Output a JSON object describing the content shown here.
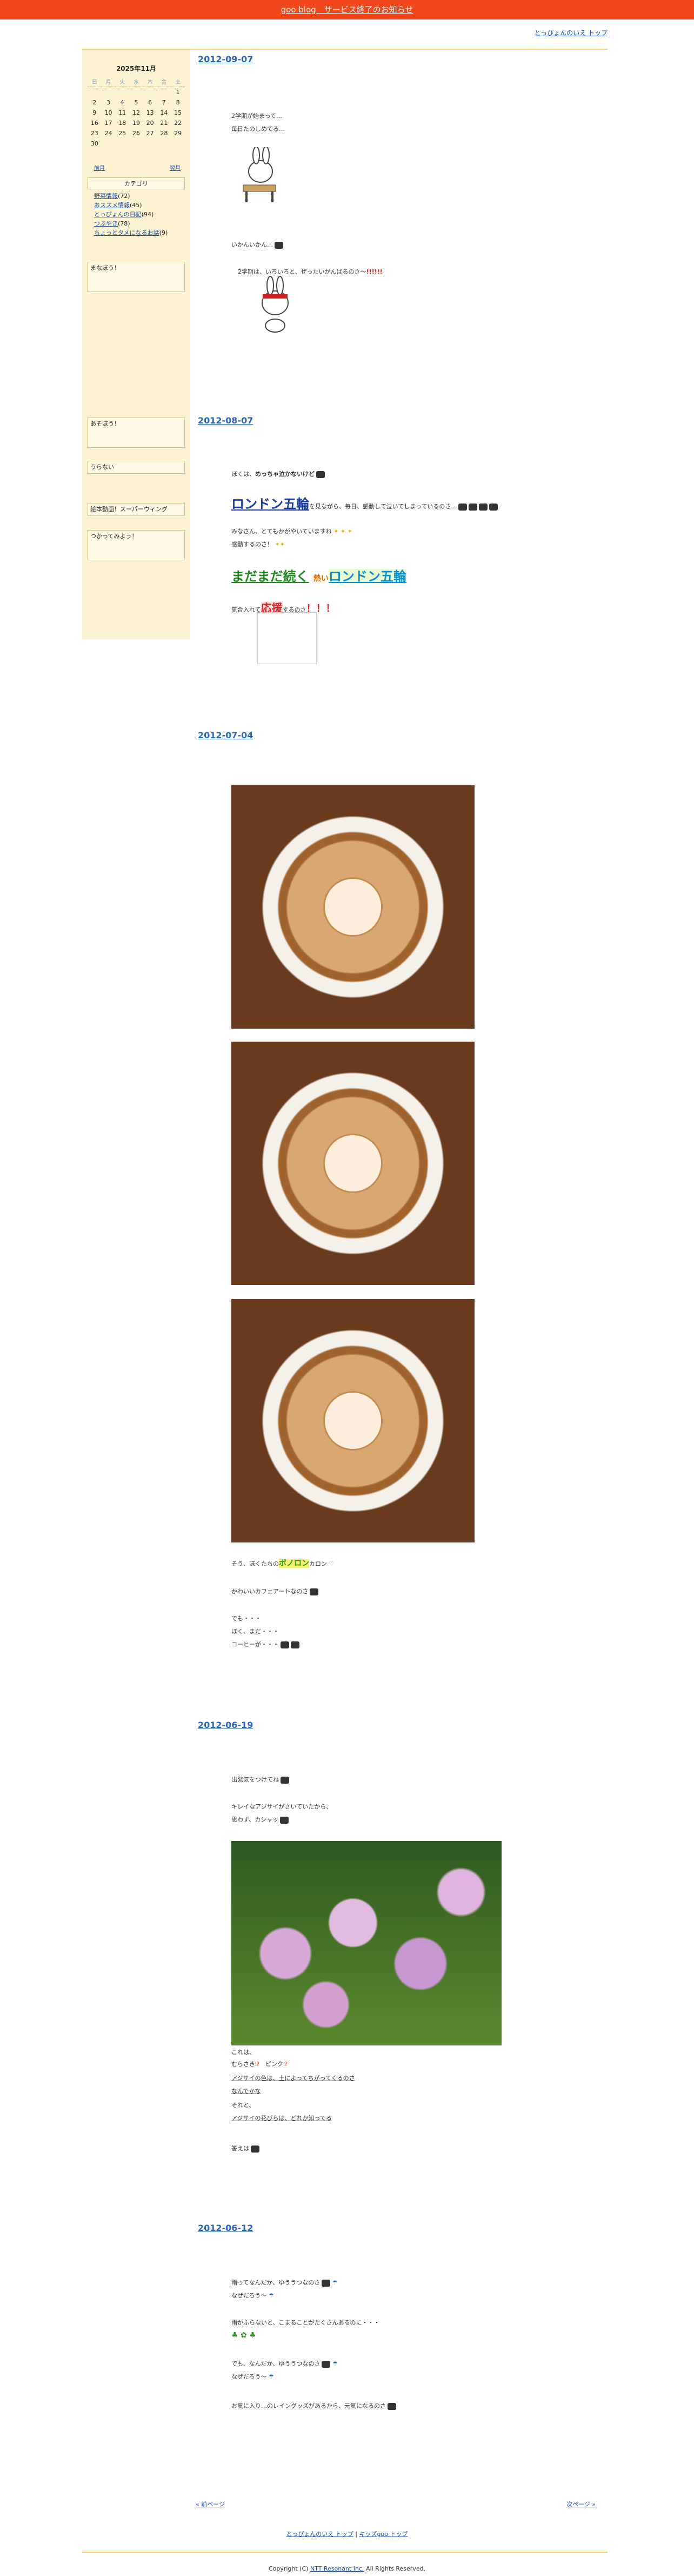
{
  "topbar": {
    "notice": "goo blog　サービス終了のお知らせ"
  },
  "header": {
    "top_link": "とっぴょんのいえ トップ"
  },
  "sidebar": {
    "calendar": {
      "title": "2025年11月",
      "weekdays": [
        "日",
        "月",
        "火",
        "水",
        "木",
        "金",
        "土"
      ],
      "rows": [
        [
          "",
          "",
          "",
          "",
          "",
          "",
          "1"
        ],
        [
          "2",
          "3",
          "4",
          "5",
          "6",
          "7",
          "8"
        ],
        [
          "9",
          "10",
          "11",
          "12",
          "13",
          "14",
          "15"
        ],
        [
          "16",
          "17",
          "18",
          "19",
          "20",
          "21",
          "22"
        ],
        [
          "23",
          "24",
          "25",
          "26",
          "27",
          "28",
          "29"
        ],
        [
          "30",
          "",
          "",
          "",
          "",
          "",
          ""
        ]
      ],
      "prev": "前月",
      "next": "翌月"
    },
    "category_title": "カテゴリ",
    "categories": [
      {
        "label": "野菜情報",
        "count": "(72)"
      },
      {
        "label": "おススメ情報",
        "count": "(45)"
      },
      {
        "label": "とっぴょんの日記",
        "count": "(94)"
      },
      {
        "label": "つぶやき",
        "count": "(78)"
      },
      {
        "label": "ちょっとタメになるお話",
        "count": "(9)"
      }
    ],
    "box_manabou": "まなぼう！",
    "box_asobou": "あそぼう！",
    "box_uranai": "うらない",
    "box_ohanashi": "絵本動画！スーパーウィング",
    "box_tsukatte": "つかってみよう！"
  },
  "posts": {
    "p1": {
      "date": "2012-09-07",
      "l1": "2学期が始まって…",
      "l2": "毎日たのしめてる…",
      "l3": "いかんいかん…",
      "l4": "2学期は、いろいろと、ぜったいがんばるのさ〜",
      "exclaim": "!!!!!!"
    },
    "p2": {
      "date": "2012-08-07",
      "l1a": "ぼくは、",
      "l1b": "めっちゃ泣かないけど",
      "big1": "ロンドン五輪",
      "l2": "を見ながら、毎日、感動して泣いてしまっているのさ…",
      "l3": "みなさん、とてもかがやいていますね",
      "l4": "感動するのさ！",
      "big2a": "まだまだ続く",
      "big2b": "熱い",
      "big2c": "ロンドン五輪",
      "l5a": "気合入れて",
      "l5b": "応援",
      "l5c": "するのさ",
      "l5d": "！！！"
    },
    "p3": {
      "date": "2012-07-04",
      "l1a": "そう、ぼくたちの",
      "l1b": "ボノロン",
      "l1c": "カロン",
      "l2": "かわいいカフェアートなのさ",
      "l3": "でも・・・",
      "l4": "ぼく、まだ・・・",
      "l5": "コーヒーが・・・"
    },
    "p4": {
      "date": "2012-06-19",
      "l1": "出発気をつけてね",
      "l2": "キレイなアジサイがさいていたから、",
      "l3": "思わず、カシャッ",
      "l4": "これは、",
      "l5": "むらさき",
      "l5b": "ピンク",
      "link1": "アジサイの色は、土によってちがってくるのさ",
      "link2": "なんでかな",
      "l6": "それと、",
      "link3": "アジサイの花びらは、どれか知ってる",
      "l7": "答えは"
    },
    "p5": {
      "date": "2012-06-12",
      "l1": "雨ってなんだか、ゆううつなのさ",
      "l2": "なぜだろう〜",
      "l3": "雨がふらないと、こまることがたくさんあるのに・・・",
      "l4": "でも、なんだか、ゆううつなのさ",
      "l5": "なぜだろう〜",
      "l6": "お気に入り…のレイングッズがあるから、元気になるのさ"
    }
  },
  "footer": {
    "prev_page": "« 前ページ",
    "next_page": "次ページ »",
    "link_home": "とっぴょんのいえ トップ",
    "link_sep": " | ",
    "link_kids": "キッズgoo トップ",
    "copyright_pre": "Copyright (C) ",
    "copyright_link": "NTT Resonant Inc.",
    "copyright_post": " All Rights Reserved."
  },
  "colors": {
    "accent": "#f2461b",
    "date": "#2a66b8",
    "sidebar_bg": "#fbf3d2"
  }
}
